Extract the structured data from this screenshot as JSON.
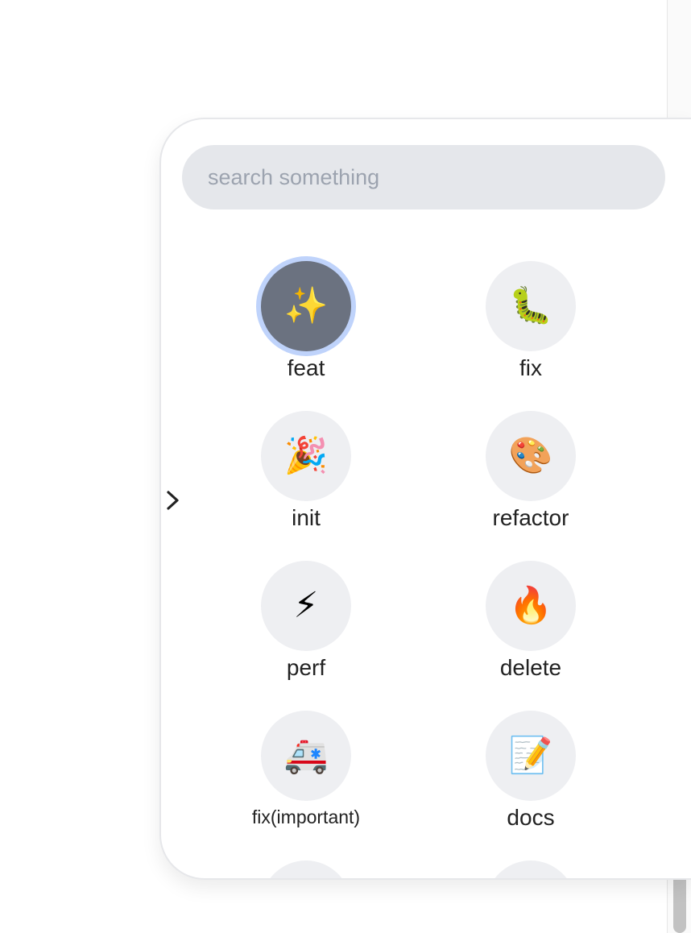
{
  "search": {
    "placeholder": "search something"
  },
  "toggle": {
    "icon": "chevron-right-icon"
  },
  "items": [
    {
      "label": "feat",
      "emoji": "✨",
      "icon": "sparkles-icon",
      "selected": true
    },
    {
      "label": "fix",
      "emoji": "🐛",
      "icon": "bug-icon"
    },
    {
      "label": "init",
      "emoji": "🎉",
      "icon": "party-popper-icon"
    },
    {
      "label": "refactor",
      "emoji": "🎨",
      "icon": "palette-icon"
    },
    {
      "label": "perf",
      "emoji": "⚡",
      "icon": "lightning-icon"
    },
    {
      "label": "delete",
      "emoji": "🔥",
      "icon": "fire-icon"
    },
    {
      "label": "fix(important)",
      "emoji": "🚑",
      "icon": "ambulance-icon"
    },
    {
      "label": "docs",
      "emoji": "📝",
      "icon": "memo-icon"
    }
  ],
  "colors": {
    "selected_circle": "#6b7280",
    "selected_ring": "#bfd3fb",
    "circle": "#eeeff2",
    "search_bg": "#e5e7eb"
  }
}
